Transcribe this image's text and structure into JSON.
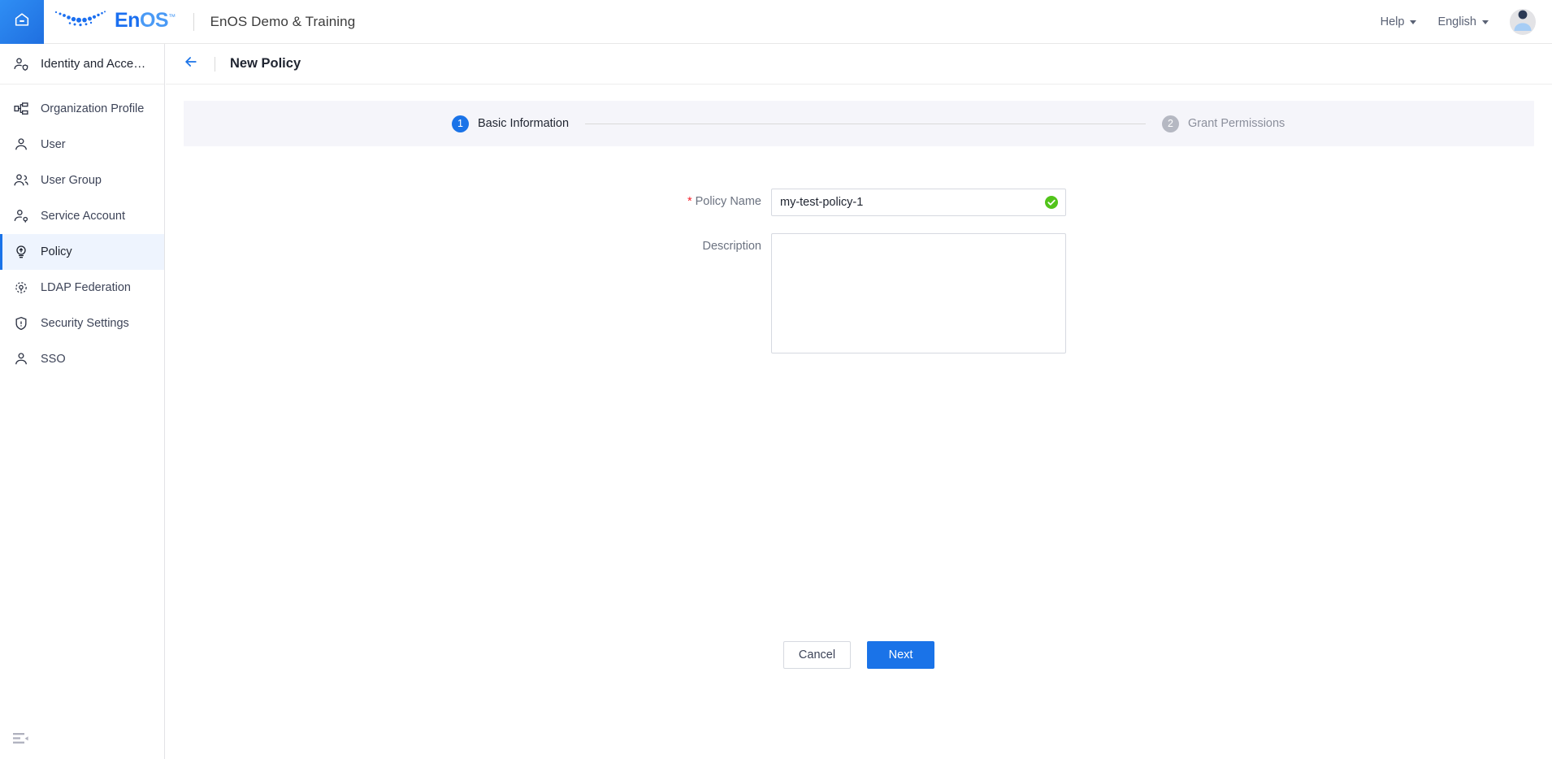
{
  "topbar": {
    "home_icon": "home-icon",
    "logo_text_primary": "En",
    "logo_text_secondary": "OS",
    "logo_trademark": "™",
    "org_title": "EnOS Demo & Training",
    "help_label": "Help",
    "language_label": "English",
    "avatar_icon": "user-avatar-icon"
  },
  "sidebar": {
    "header": {
      "label": "Identity and Acce…",
      "icon": "identity-user-shield-icon"
    },
    "items": [
      {
        "label": "Organization Profile",
        "icon": "org-chart-icon",
        "active": false
      },
      {
        "label": "User",
        "icon": "user-icon",
        "active": false
      },
      {
        "label": "User Group",
        "icon": "user-group-icon",
        "active": false
      },
      {
        "label": "Service Account",
        "icon": "service-account-icon",
        "active": false
      },
      {
        "label": "Policy",
        "icon": "policy-bulb-icon",
        "active": true
      },
      {
        "label": "LDAP Federation",
        "icon": "ldap-federation-icon",
        "active": false
      },
      {
        "label": "Security Settings",
        "icon": "shield-icon",
        "active": false
      },
      {
        "label": "SSO",
        "icon": "sso-user-icon",
        "active": false
      }
    ],
    "collapse_icon": "collapse-sidebar-icon"
  },
  "page": {
    "back_icon": "back-arrow-icon",
    "title": "New Policy"
  },
  "stepper": {
    "steps": [
      {
        "number": "1",
        "label": "Basic Information",
        "state": "active"
      },
      {
        "number": "2",
        "label": "Grant Permissions",
        "state": "inactive"
      }
    ]
  },
  "form": {
    "policy_name": {
      "label": "Policy Name",
      "required_marker": "*",
      "value": "my-test-policy-1",
      "placeholder": "",
      "validation_icon": "green-check-icon"
    },
    "description": {
      "label": "Description",
      "value": "",
      "placeholder": ""
    }
  },
  "footer": {
    "cancel_label": "Cancel",
    "next_label": "Next"
  },
  "colors": {
    "accent_blue": "#1a73e8",
    "logo_blue": "#1b6ff0",
    "success_green": "#52c41a",
    "required_red": "#f5222d",
    "stepper_bg": "#f5f5fa",
    "sidebar_active_bg": "#eef4fe"
  }
}
